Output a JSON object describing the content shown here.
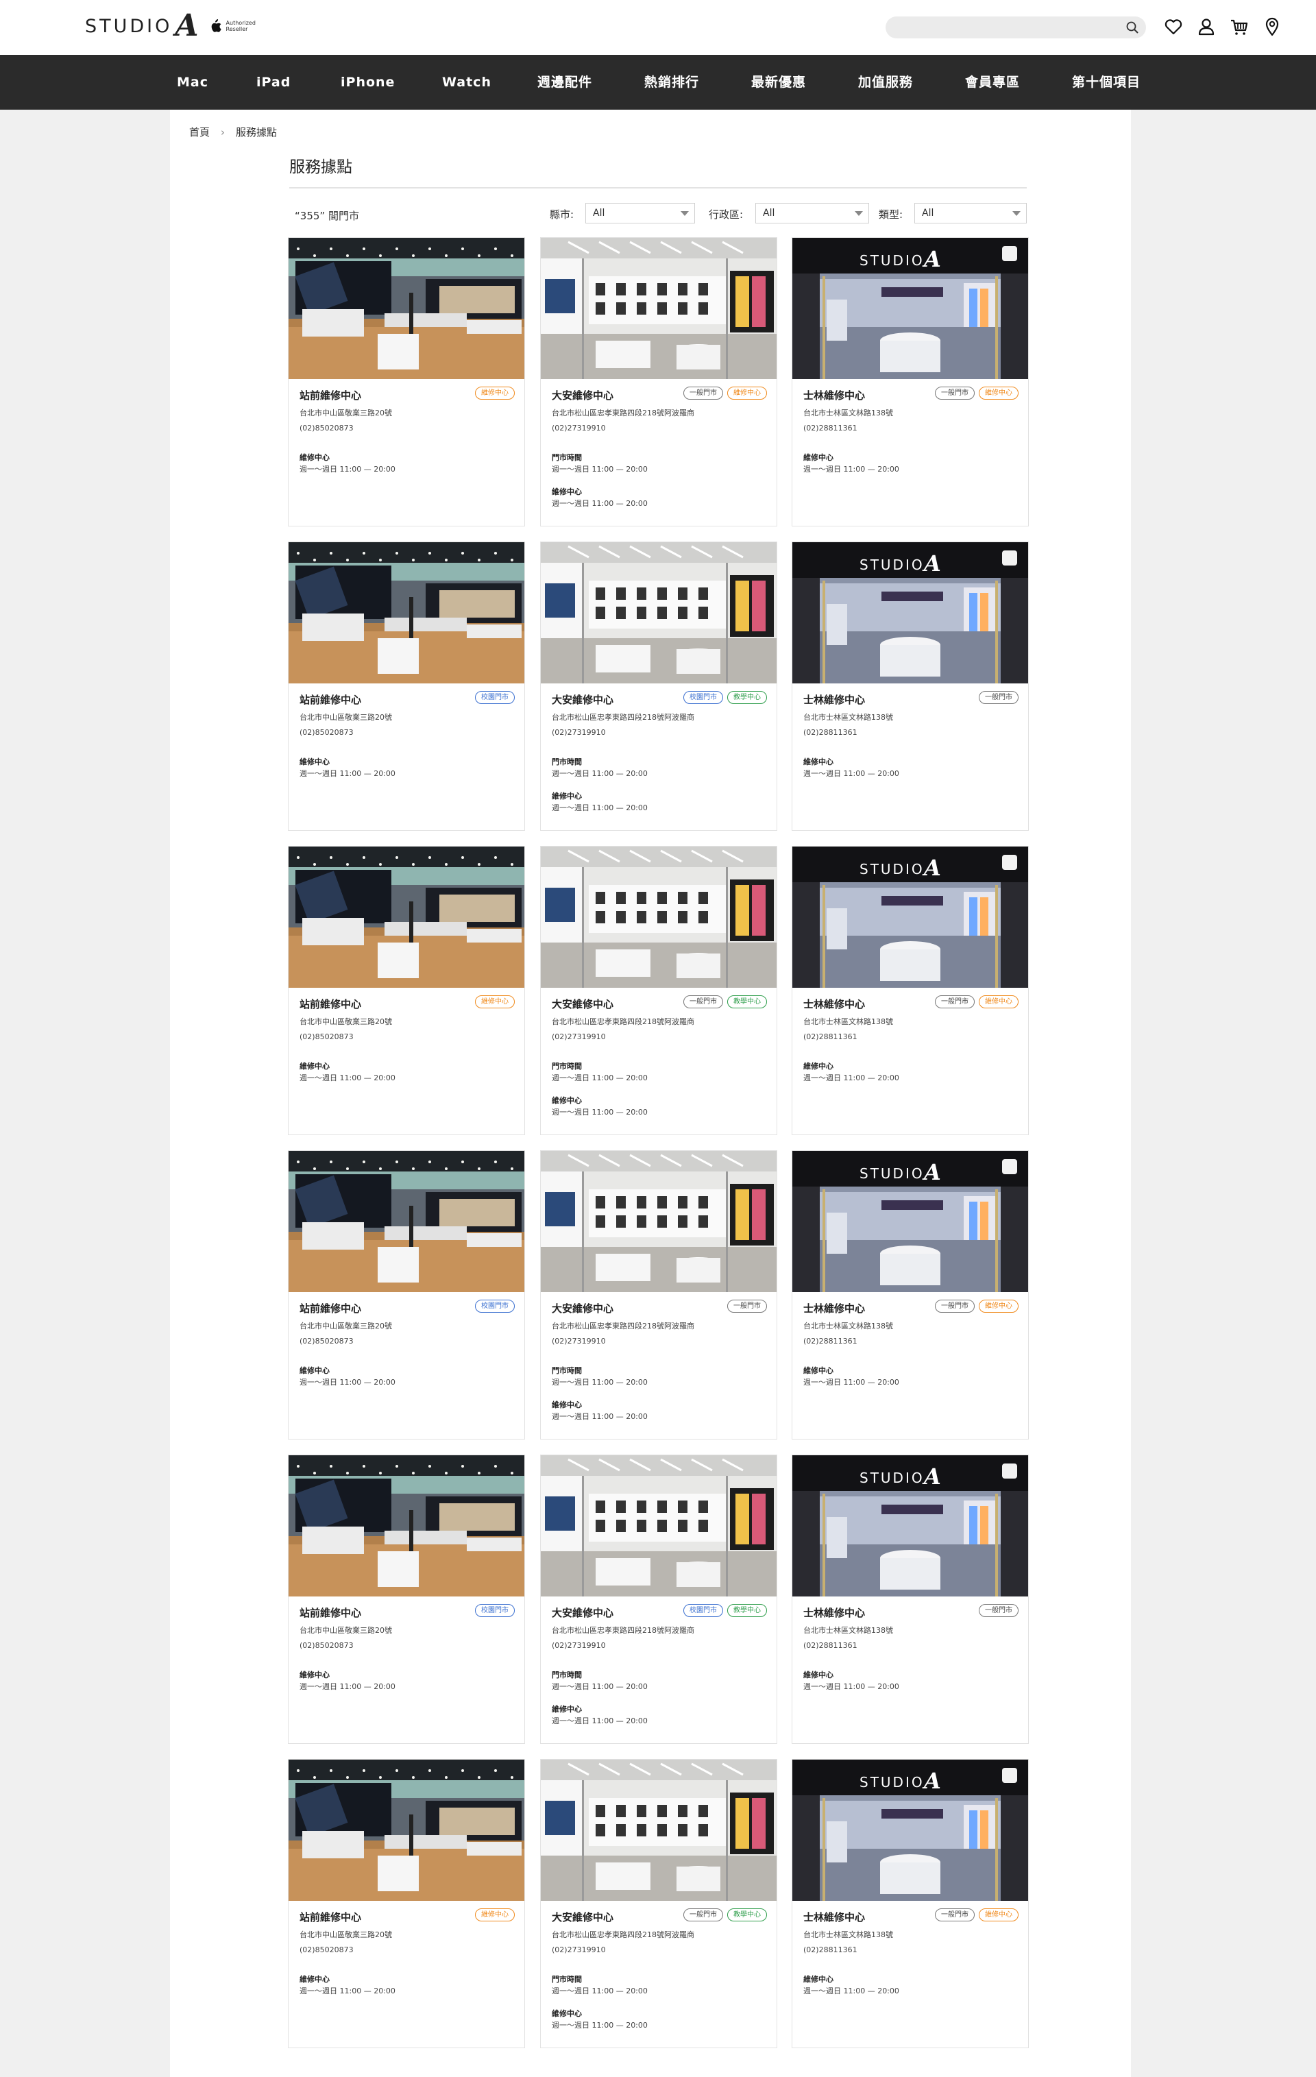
{
  "header": {
    "logo_text": "STUDIO",
    "logo_letter": "A",
    "reseller_line1": "Authorized",
    "reseller_line2": "Reseller",
    "search_placeholder": ""
  },
  "nav": {
    "items": [
      "Mac",
      "iPad",
      "iPhone",
      "Watch",
      "週邊配件",
      "熱銷排行",
      "最新優惠",
      "加值服務",
      "會員專區",
      "第十個項目"
    ]
  },
  "breadcrumb": {
    "home": "首頁",
    "current": "服務據點"
  },
  "page_title": "服務據點",
  "filters": {
    "count_label": "“355” 間門市",
    "city_label": "縣市:",
    "city_value": "All",
    "district_label": "行政區:",
    "district_value": "All",
    "type_label": "類型:",
    "type_value": "All"
  },
  "stores": [
    {
      "name": "站前維修中心",
      "address": "台北市中山區敬業三路20號",
      "phone": "(02)85020873",
      "hours": [
        {
          "label": "維修中心",
          "time": "週一～週日 11:00 — 20:00"
        }
      ]
    },
    {
      "name": "大安維修中心",
      "address": "台北市松山區忠孝東路四段218號阿波羅商",
      "phone": "(02)27319910",
      "hours": [
        {
          "label": "門市時間",
          "time": "週一～週日 11:00 — 20:00"
        },
        {
          "label": "維修中心",
          "time": "週一～週日 11:00 — 20:00"
        }
      ]
    },
    {
      "name": "士林維修中心",
      "address": "台北市士林區文林路138號",
      "phone": "(02)28811361",
      "hours": [
        {
          "label": "維修中心",
          "time": "週一～週日 11:00 — 20:00"
        }
      ]
    }
  ],
  "badge_rows": [
    [
      [
        "維修中心"
      ],
      [
        "一般門市",
        "維修中心"
      ],
      [
        "一般門市",
        "維修中心"
      ]
    ],
    [
      [
        "校園門市"
      ],
      [
        "校園門市",
        "教學中心"
      ],
      [
        "一般門市"
      ]
    ],
    [
      [
        "維修中心"
      ],
      [
        "一般門市",
        "教學中心"
      ],
      [
        "一般門市",
        "維修中心"
      ]
    ],
    [
      [
        "校園門市"
      ],
      [
        "一般門市"
      ],
      [
        "一般門市",
        "維修中心"
      ]
    ],
    [
      [
        "校園門市"
      ],
      [
        "校園門市",
        "教學中心"
      ],
      [
        "一般門市"
      ]
    ],
    [
      [
        "維修中心"
      ],
      [
        "一般門市",
        "教學中心"
      ],
      [
        "一般門市",
        "維修中心"
      ]
    ]
  ],
  "badge_colors": {
    "維修中心": "#f08a1c",
    "校園門市": "#3a6fd0",
    "教學中心": "#2e9e4b",
    "一般門市": "#777777"
  },
  "colors": {
    "nav_bg": "#2b2b2b",
    "accent_orange": "#f08a1c"
  }
}
